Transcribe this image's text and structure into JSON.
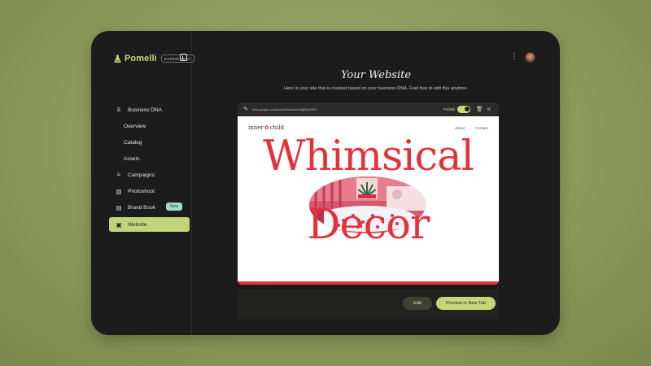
{
  "app": {
    "name": "Pomelli",
    "badge": "EXPERIMENT"
  },
  "sidebar": {
    "items": [
      {
        "label": "Business DNA",
        "icon": "dna-icon"
      },
      {
        "label": "Overview"
      },
      {
        "label": "Catalog"
      },
      {
        "label": "Assets"
      },
      {
        "label": "Campaigns",
        "icon": "campaign-icon"
      },
      {
        "label": "Photoshoot",
        "icon": "image-icon"
      },
      {
        "label": "Brand Book",
        "icon": "book-icon",
        "badge": "New"
      },
      {
        "label": "Website",
        "icon": "website-icon",
        "active": true
      }
    ]
  },
  "main": {
    "title": "Your Website",
    "subtitle": "Here is your site that is created based on your business DNA. Feel free to edit this anytime."
  },
  "browser": {
    "url": "labs.google.com/pomelli/website/fqj9f0je9f23",
    "publish_label": "Publish",
    "publish_on": true
  },
  "site": {
    "logo_left": "inner",
    "logo_right": "child",
    "nav": [
      "About",
      "Contact"
    ],
    "hero_line1": "Whimsical",
    "hero_line2": "Decor"
  },
  "actions": {
    "edit_label": "Edit",
    "preview_label": "Preview in New Tab"
  },
  "colors": {
    "accent": "#c2d47a",
    "hero_red": "#e4323d",
    "background": "#1b1c1b",
    "new_badge": "#a6d8cf"
  }
}
